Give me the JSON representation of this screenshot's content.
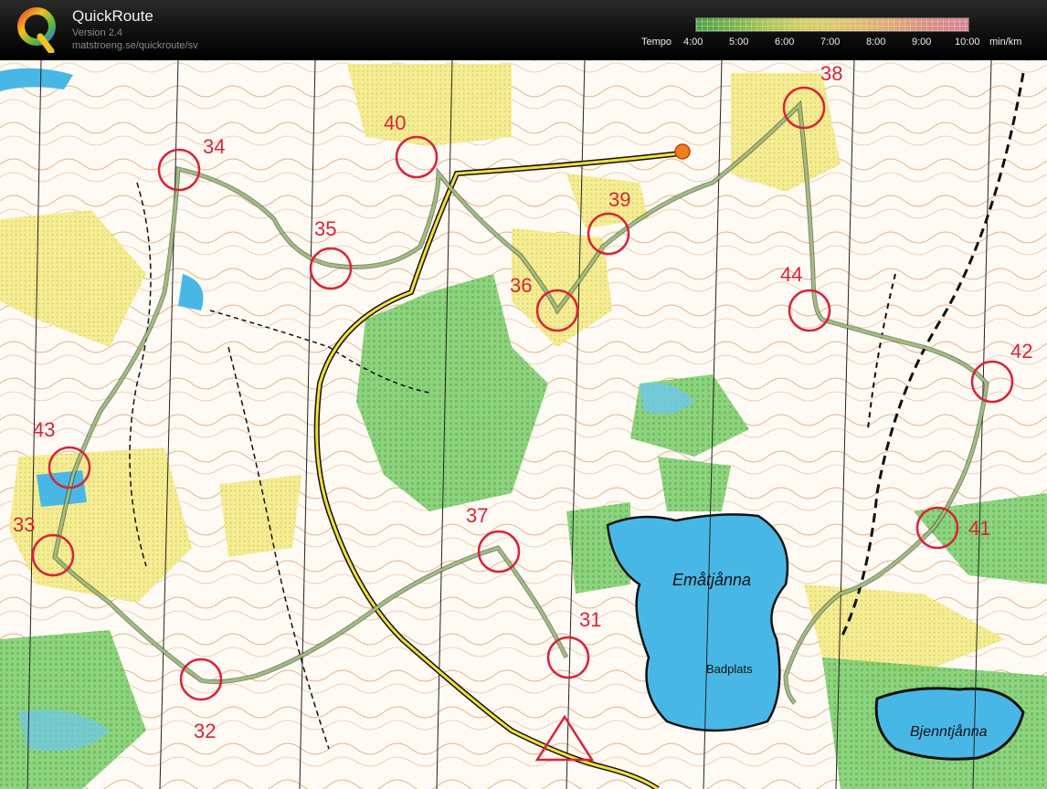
{
  "app": {
    "title": "QuickRoute",
    "version": "Version 2.4",
    "url": "matstroeng.se/quickroute/sv"
  },
  "legend": {
    "label": "Tempo",
    "ticks": [
      "4:00",
      "5:00",
      "6:00",
      "7:00",
      "8:00",
      "9:00",
      "10:00"
    ],
    "unit": "min/km"
  },
  "map": {
    "controls": [
      "31",
      "32",
      "33",
      "34",
      "35",
      "36",
      "37",
      "38",
      "39",
      "40",
      "41",
      "42",
      "43",
      "44"
    ],
    "lakes": {
      "main": "Emåtjånna",
      "beach": "Badplats",
      "east": "Bjenntjånna"
    }
  },
  "colors": {
    "header_bg": "#141414",
    "control_red": "#d8243a",
    "route_line": "#8aa66a",
    "water": "#49b7e6",
    "green": "#3fb45c",
    "yellow": "#f2e46a"
  },
  "icons": {
    "logo": "quickroute-q-logo"
  }
}
